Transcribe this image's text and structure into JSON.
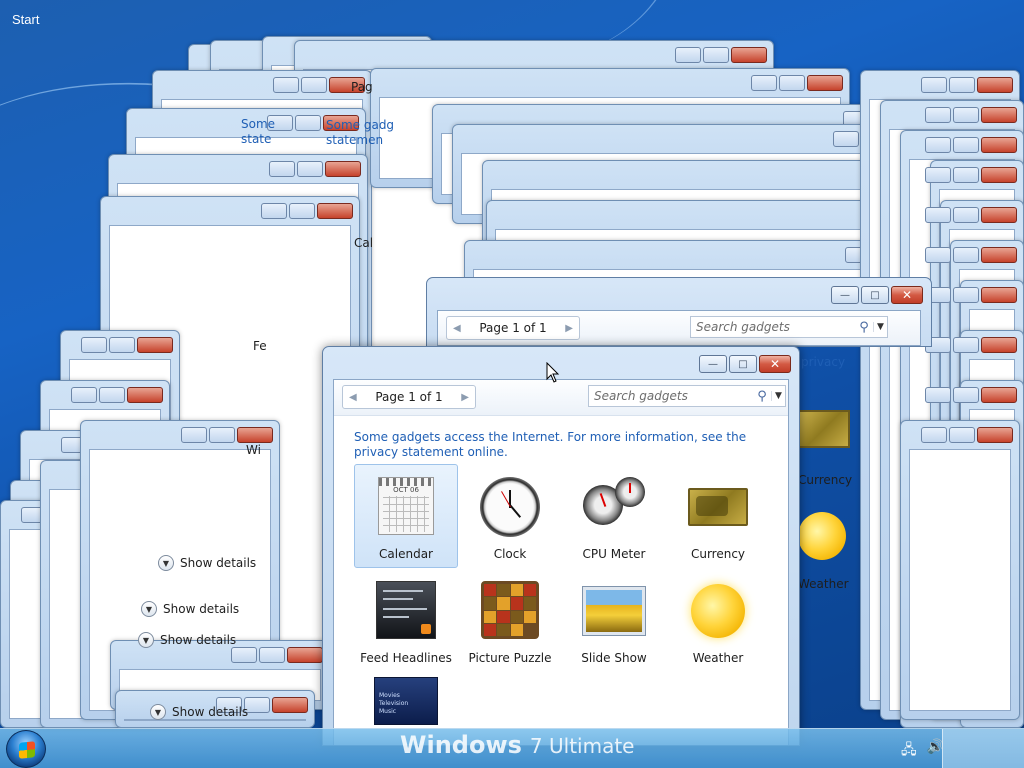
{
  "desktop": {
    "start_label": "Start"
  },
  "gadget_window": {
    "pager_label": "Page 1 of 1",
    "search_placeholder": "Search gadgets",
    "notice": "Some gadgets access the Internet.  For more information, see the privacy statement online.",
    "gadgets": [
      {
        "name": "Calendar",
        "icon": "calendar-icon",
        "selected": true
      },
      {
        "name": "Clock",
        "icon": "clock-icon"
      },
      {
        "name": "CPU Meter",
        "icon": "cpu-meter-icon"
      },
      {
        "name": "Currency",
        "icon": "currency-icon"
      },
      {
        "name": "Feed Headlines",
        "icon": "feed-headlines-icon"
      },
      {
        "name": "Picture Puzzle",
        "icon": "picture-puzzle-icon"
      },
      {
        "name": "Slide Show",
        "icon": "slide-show-icon"
      },
      {
        "name": "Weather",
        "icon": "weather-icon"
      },
      {
        "name": "",
        "icon": "media-center-icon"
      }
    ],
    "media_lines": [
      "Movies",
      "Television",
      "Music"
    ]
  },
  "background_window": {
    "pager_label": "Page 1 of 1",
    "search_placeholder": "Search gadgets",
    "privacy_fragment": "privacy",
    "currency_label": "Currency",
    "weather_label": "Weather"
  },
  "background_fragments": {
    "show_details": "Show details",
    "page_fragment": "Pag",
    "notice_fragment_1": "Some gadg",
    "notice_fragment_2": "statemen",
    "notice_fragment_3": "Some",
    "notice_fragment_4": "state",
    "cal_fragment": "Cal",
    "feed_fragment": "Fe",
    "win_fragment": "Wi"
  },
  "taskbar": {
    "brand": "Windows",
    "edition": "7  Ultimate"
  },
  "colors": {
    "link_blue": "#1f5fb5",
    "close_red": "#c13d28",
    "desktop_blue": "#1763c4"
  }
}
